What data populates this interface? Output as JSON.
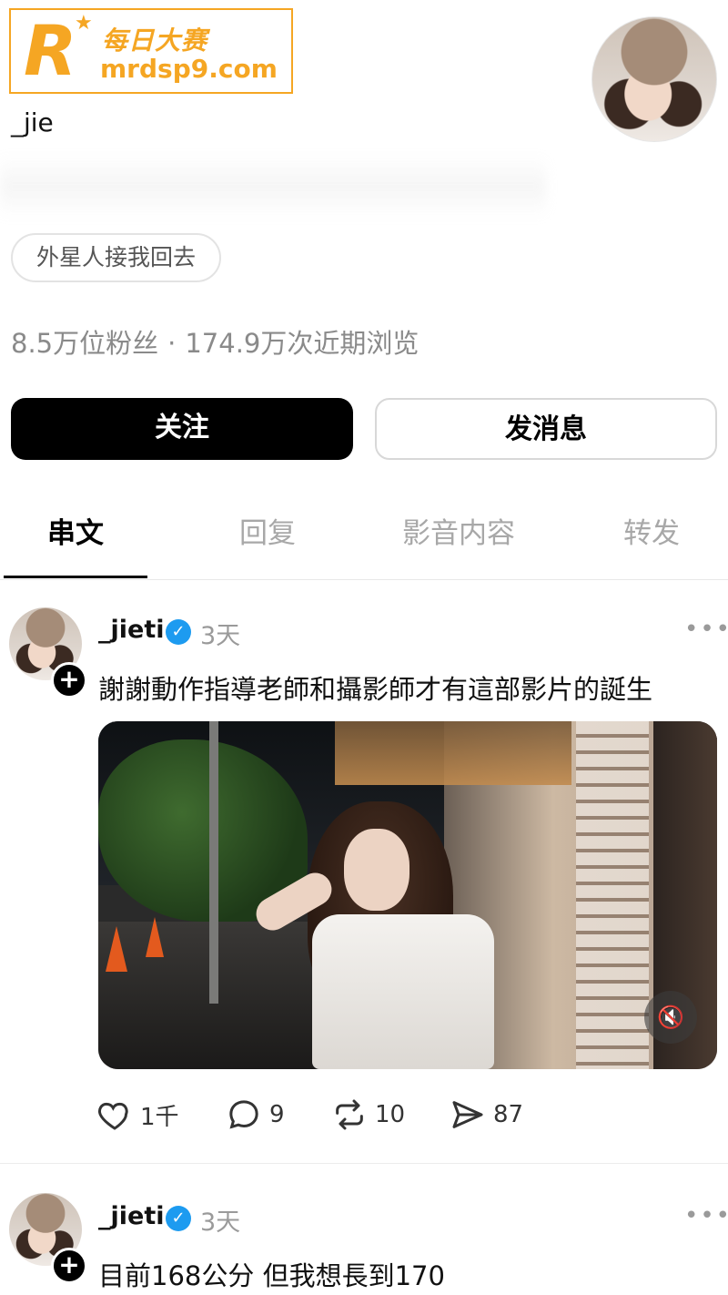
{
  "watermark": {
    "brand_cn": "每日大赛",
    "url": "mrdsp9.com"
  },
  "profile": {
    "username": "_jie",
    "tag": "外星人接我回去",
    "followers": "8.5万位粉丝",
    "separator": "·",
    "views": "174.9万次近期浏览"
  },
  "buttons": {
    "follow": "关注",
    "message": "发消息"
  },
  "tabs": [
    "串文",
    "回复",
    "影音内容",
    "转发"
  ],
  "posts": [
    {
      "user": "_jieti",
      "time": "3天",
      "text": "謝謝動作指導老師和攝影師才有這部影片的誕生",
      "likes": "1千",
      "comments": "9",
      "reposts": "10",
      "shares": "87"
    },
    {
      "user": "_jieti",
      "time": "3天",
      "text": "目前168公分 但我想長到170"
    }
  ],
  "colors": {
    "watermark": "#f5a623",
    "verified": "#1d9bf0",
    "muted_text": "#9a9a9a"
  }
}
